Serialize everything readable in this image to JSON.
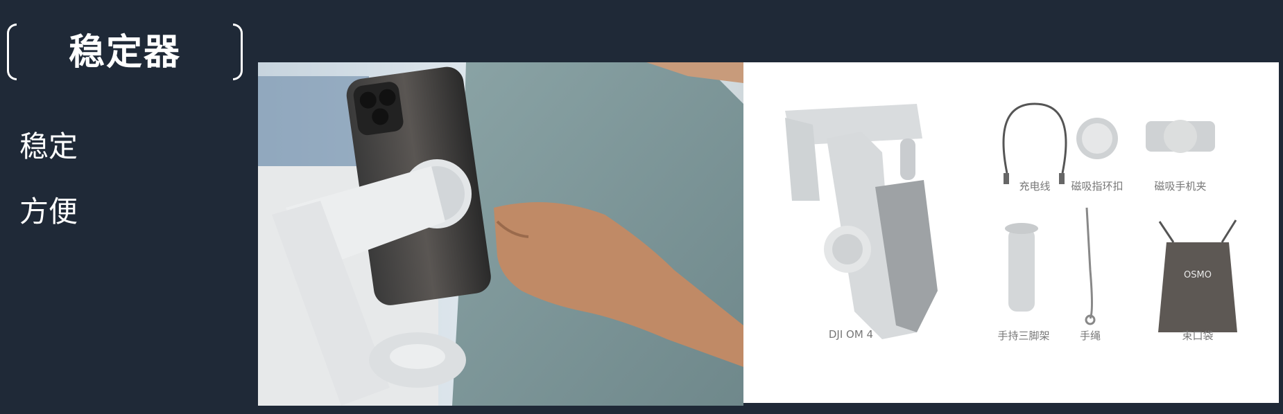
{
  "header": {
    "title": "稳定器"
  },
  "features": [
    "稳定",
    "方便"
  ],
  "product_image": {
    "main_label": "DJI OM 4",
    "accessories": [
      "充电线",
      "磁吸指环扣",
      "磁吸手机夹",
      "手持三脚架",
      "手绳",
      "束口袋"
    ],
    "bag_text": "OSMO"
  },
  "colors": {
    "background": "#1f2937",
    "text": "#ffffff"
  }
}
